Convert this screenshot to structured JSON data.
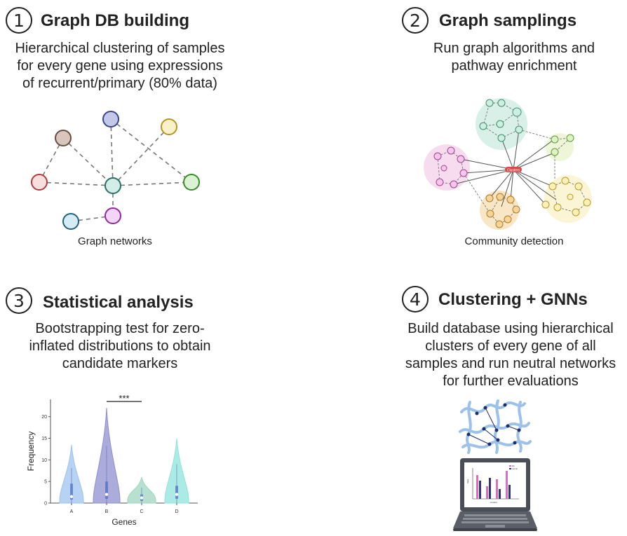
{
  "steps": [
    {
      "number": "1",
      "title": "Graph DB building",
      "lines": [
        "Hierarchical clustering of samples",
        "for every gene using expressions",
        "of recurrent/primary (80% data)"
      ],
      "caption": "Graph networks"
    },
    {
      "number": "2",
      "title": "Graph samplings",
      "lines": [
        "Run graph algorithms and",
        "pathway enrichment"
      ],
      "caption": "Community detection",
      "hub_label": "Clusters"
    },
    {
      "number": "3",
      "title": "Statistical analysis",
      "lines": [
        "Bootstrapping test for zero-",
        "inflated distributions to obtain",
        "candidate markers"
      ]
    },
    {
      "number": "4",
      "title": "Clustering + GNNs",
      "lines": [
        "Build database using hierarchical",
        "clusters of every gene of all",
        "samples and run neutral networks",
        "for further evaluations"
      ]
    }
  ],
  "chart_data": {
    "type": "violin",
    "xlabel": "Genes",
    "ylabel": "Frequency",
    "categories": [
      "A",
      "B",
      "C",
      "D"
    ],
    "yticks": [
      0,
      5,
      10,
      15,
      20
    ],
    "ylim": [
      0,
      24
    ],
    "significance": "***",
    "colors": [
      "#9fc3ef",
      "#8f8fd0",
      "#9fd6c2",
      "#8fe4dc"
    ],
    "series": [
      {
        "category": "A",
        "max": 13.5,
        "median": 1.5,
        "q1": 0.8,
        "q3": 4.5
      },
      {
        "category": "B",
        "max": 22,
        "median": 2,
        "q1": 1,
        "q3": 5
      },
      {
        "category": "C",
        "max": 6,
        "median": 1.2,
        "q1": 0.5,
        "q3": 2
      },
      {
        "category": "D",
        "max": 15,
        "median": 2,
        "q1": 1,
        "q3": 4
      }
    ]
  },
  "icons": {
    "laptop": "laptop-icon",
    "network": "neural-network-icon"
  },
  "laptop_screen": {
    "legend": [
      "AD",
      "normal"
    ],
    "ylabel": "Value",
    "xlabel": "Condition"
  }
}
